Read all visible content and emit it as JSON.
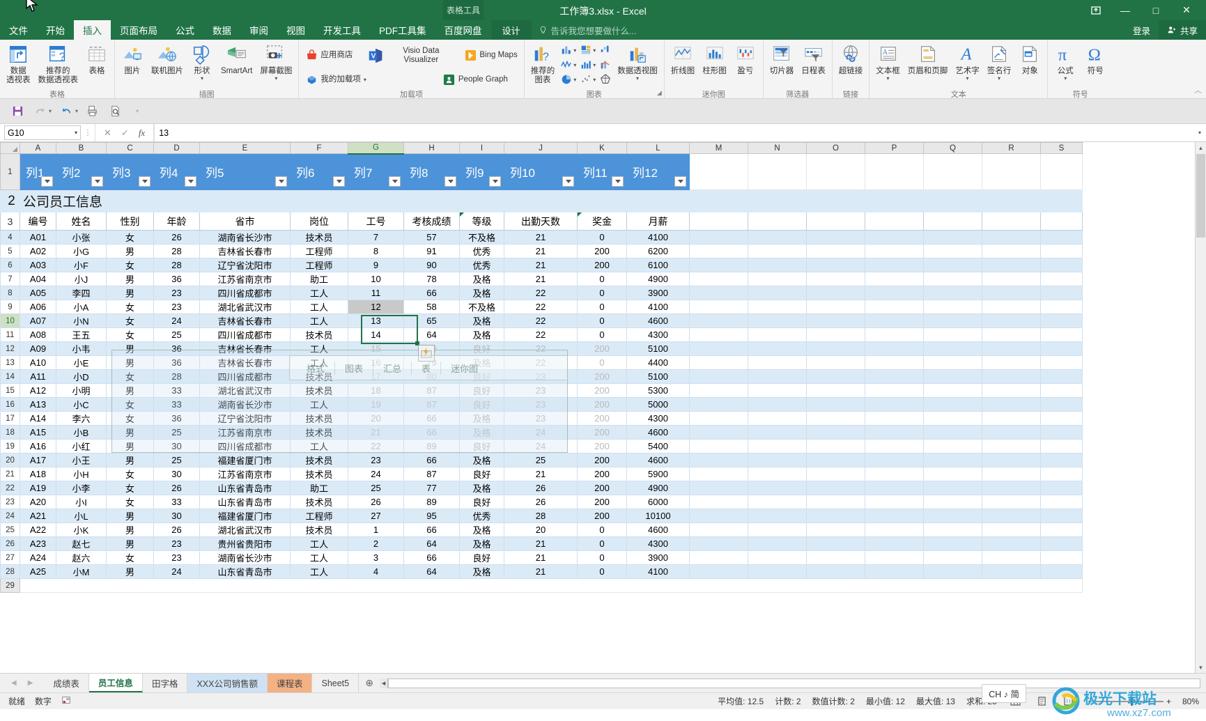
{
  "titlebar": {
    "contextual_group": "表格工具",
    "document_title": "工作簿3.xlsx - Excel",
    "ribbon_display_icon": "ribbon-display-options-icon",
    "minimize": "—",
    "maximize": "□",
    "close": "✕"
  },
  "tabs": {
    "items": [
      "文件",
      "开始",
      "插入",
      "页面布局",
      "公式",
      "数据",
      "审阅",
      "视图",
      "开发工具",
      "PDF工具集",
      "百度网盘"
    ],
    "active": "插入",
    "contextual": "设计",
    "tellme_placeholder": "告诉我您想要做什么...",
    "signin": "登录",
    "share": "共享"
  },
  "ribbon": {
    "groups": [
      {
        "name": "表格",
        "items": [
          {
            "label": "数据\n透视表",
            "icon": "pivot-table-icon"
          },
          {
            "label": "推荐的\n数据透视表",
            "icon": "recommended-pivot-icon"
          },
          {
            "label": "表格",
            "icon": "table-icon"
          }
        ]
      },
      {
        "name": "插图",
        "items": [
          {
            "label": "图片",
            "icon": "picture-icon"
          },
          {
            "label": "联机图片",
            "icon": "online-picture-icon"
          },
          {
            "label": "形状",
            "icon": "shapes-icon"
          },
          {
            "label": "SmartArt",
            "icon": "smartart-icon"
          },
          {
            "label": "屏幕截图",
            "icon": "screenshot-icon"
          }
        ]
      },
      {
        "name": "加载项",
        "items": [
          {
            "label": "应用商店",
            "icon": "store-icon"
          },
          {
            "label": "我的加载项",
            "icon": "my-addins-icon"
          },
          {
            "label": "Visio Data Visualizer",
            "icon": "visio-icon"
          },
          {
            "label": "Bing Maps",
            "icon": "bing-maps-icon"
          },
          {
            "label": "People Graph",
            "icon": "people-graph-icon"
          }
        ]
      },
      {
        "name": "图表",
        "items": [
          {
            "label": "推荐的\n图表",
            "icon": "recommended-charts-icon"
          },
          {
            "label": "数据透视图",
            "icon": "pivot-chart-icon"
          }
        ],
        "gallery": [
          "column-chart-icon",
          "hierarchy-chart-icon",
          "waterfall-chart-icon",
          "line-chart-icon",
          "statistic-chart-icon",
          "combo-chart-icon",
          "pie-chart-icon",
          "scatter-chart-icon",
          "radar-chart-icon"
        ]
      },
      {
        "name": "迷你图",
        "items": [
          {
            "label": "折线图",
            "icon": "sparkline-line-icon"
          },
          {
            "label": "柱形图",
            "icon": "sparkline-column-icon"
          },
          {
            "label": "盈亏",
            "icon": "sparkline-winloss-icon"
          }
        ]
      },
      {
        "name": "筛选器",
        "items": [
          {
            "label": "切片器",
            "icon": "slicer-icon"
          },
          {
            "label": "日程表",
            "icon": "timeline-icon"
          }
        ]
      },
      {
        "name": "链接",
        "items": [
          {
            "label": "超链接",
            "icon": "hyperlink-icon"
          }
        ]
      },
      {
        "name": "文本",
        "items": [
          {
            "label": "文本框",
            "icon": "textbox-icon"
          },
          {
            "label": "页眉和页脚",
            "icon": "header-footer-icon"
          },
          {
            "label": "艺术字",
            "icon": "wordart-icon"
          },
          {
            "label": "签名行",
            "icon": "signature-line-icon"
          },
          {
            "label": "对象",
            "icon": "object-icon"
          }
        ]
      },
      {
        "name": "符号",
        "items": [
          {
            "label": "公式",
            "icon": "equation-icon"
          },
          {
            "label": "符号",
            "icon": "symbol-icon"
          }
        ]
      }
    ]
  },
  "qat": {
    "buttons": [
      "save-icon",
      "redo-icon",
      "undo-icon",
      "print-preview-icon",
      "quick-print-icon",
      "customize-qat-icon"
    ]
  },
  "formula_bar": {
    "name_box": "G10",
    "cancel_icon": "✕",
    "confirm_icon": "✓",
    "function_icon": "fx",
    "value": "13"
  },
  "grid": {
    "column_headers": [
      "A",
      "B",
      "C",
      "D",
      "E",
      "F",
      "G",
      "H",
      "I",
      "J",
      "K",
      "L",
      "M",
      "N",
      "O",
      "P",
      "Q",
      "R",
      "S"
    ],
    "selected_column": "G",
    "selected_row": "10",
    "row_numbers": [
      "1",
      "2",
      "3",
      "4",
      "5",
      "6",
      "7",
      "8",
      "9",
      "10",
      "11",
      "12",
      "13",
      "14",
      "15",
      "16",
      "17",
      "18",
      "19",
      "20",
      "21",
      "22",
      "23",
      "24",
      "25",
      "26",
      "27",
      "28",
      "29"
    ],
    "table_header_labels": [
      "列1",
      "列2",
      "列3",
      "列4",
      "列5",
      "列6",
      "列7",
      "列8",
      "列9",
      "列10",
      "列11",
      "列12"
    ],
    "banner_title": "公司员工信息",
    "column_titles": [
      "编号",
      "姓名",
      "性别",
      "年龄",
      "省市",
      "岗位",
      "工号",
      "考核成绩",
      "等级",
      "出勤天数",
      "奖金",
      "月薪"
    ],
    "rows": [
      [
        "A01",
        "小张",
        "女",
        "26",
        "湖南省长沙市",
        "技术员",
        "7",
        "57",
        "不及格",
        "21",
        "0",
        "4100"
      ],
      [
        "A02",
        "小G",
        "男",
        "28",
        "吉林省长春市",
        "工程师",
        "8",
        "91",
        "优秀",
        "21",
        "200",
        "6200"
      ],
      [
        "A03",
        "小F",
        "女",
        "28",
        "辽宁省沈阳市",
        "工程师",
        "9",
        "90",
        "优秀",
        "21",
        "200",
        "6100"
      ],
      [
        "A04",
        "小J",
        "男",
        "36",
        "江苏省南京市",
        "助工",
        "10",
        "78",
        "及格",
        "21",
        "0",
        "4900"
      ],
      [
        "A05",
        "李四",
        "男",
        "23",
        "四川省成都市",
        "工人",
        "11",
        "66",
        "及格",
        "22",
        "0",
        "3900"
      ],
      [
        "A06",
        "小A",
        "女",
        "23",
        "湖北省武汉市",
        "工人",
        "12",
        "58",
        "不及格",
        "22",
        "0",
        "4100"
      ],
      [
        "A07",
        "小N",
        "女",
        "24",
        "吉林省长春市",
        "工人",
        "13",
        "65",
        "及格",
        "22",
        "0",
        "4600"
      ],
      [
        "A08",
        "王五",
        "女",
        "25",
        "四川省成都市",
        "技术员",
        "14",
        "64",
        "及格",
        "22",
        "0",
        "4300"
      ],
      [
        "A09",
        "小韦",
        "男",
        "36",
        "吉林省长春市",
        "工人",
        "15",
        "80",
        "良好",
        "22",
        "200",
        "5100"
      ],
      [
        "A10",
        "小E",
        "男",
        "36",
        "吉林省长春市",
        "工人",
        "16",
        "79",
        "及格",
        "22",
        "0",
        "4400"
      ],
      [
        "A11",
        "小D",
        "女",
        "28",
        "四川省成都市",
        "技术员",
        "17",
        "80",
        "良好",
        "23",
        "200",
        "5100"
      ],
      [
        "A12",
        "小明",
        "男",
        "33",
        "湖北省武汉市",
        "技术员",
        "18",
        "87",
        "良好",
        "23",
        "200",
        "5300"
      ],
      [
        "A13",
        "小C",
        "女",
        "33",
        "湖南省长沙市",
        "工人",
        "19",
        "87",
        "良好",
        "23",
        "200",
        "5000"
      ],
      [
        "A14",
        "李六",
        "女",
        "36",
        "辽宁省沈阳市",
        "技术员",
        "20",
        "66",
        "及格",
        "23",
        "200",
        "4300"
      ],
      [
        "A15",
        "小B",
        "男",
        "25",
        "江苏省南京市",
        "技术员",
        "21",
        "66",
        "及格",
        "24",
        "200",
        "4600"
      ],
      [
        "A16",
        "小红",
        "男",
        "30",
        "四川省成都市",
        "工人",
        "22",
        "89",
        "良好",
        "24",
        "200",
        "5400"
      ],
      [
        "A17",
        "小王",
        "男",
        "25",
        "福建省厦门市",
        "技术员",
        "23",
        "66",
        "及格",
        "25",
        "200",
        "4600"
      ],
      [
        "A18",
        "小H",
        "女",
        "30",
        "江苏省南京市",
        "技术员",
        "24",
        "87",
        "良好",
        "21",
        "200",
        "5900"
      ],
      [
        "A19",
        "小李",
        "女",
        "26",
        "山东省青岛市",
        "助工",
        "25",
        "77",
        "及格",
        "26",
        "200",
        "4900"
      ],
      [
        "A20",
        "小I",
        "女",
        "33",
        "山东省青岛市",
        "技术员",
        "26",
        "89",
        "良好",
        "26",
        "200",
        "6000"
      ],
      [
        "A21",
        "小L",
        "男",
        "30",
        "福建省厦门市",
        "工程师",
        "27",
        "95",
        "优秀",
        "28",
        "200",
        "10100"
      ],
      [
        "A22",
        "小K",
        "男",
        "26",
        "湖北省武汉市",
        "技术员",
        "1",
        "66",
        "及格",
        "20",
        "0",
        "4600"
      ],
      [
        "A23",
        "赵七",
        "男",
        "23",
        "贵州省贵阳市",
        "工人",
        "2",
        "64",
        "及格",
        "21",
        "0",
        "4300"
      ],
      [
        "A24",
        "赵六",
        "女",
        "23",
        "湖南省长沙市",
        "工人",
        "3",
        "66",
        "良好",
        "21",
        "0",
        "3900"
      ],
      [
        "A25",
        "小M",
        "男",
        "24",
        "山东省青岛市",
        "工人",
        "4",
        "64",
        "及格",
        "21",
        "0",
        "4100"
      ]
    ]
  },
  "quick_analysis": {
    "icon": "quick-analysis-icon",
    "tabs": [
      "格式",
      "图表",
      "汇总",
      "表",
      "迷你图"
    ]
  },
  "sheet_tabs": {
    "prev_icon": "◀",
    "next_icon": "▶",
    "items": [
      {
        "label": "成绩表",
        "color": "none",
        "active": false
      },
      {
        "label": "员工信息",
        "color": "none",
        "active": true
      },
      {
        "label": "田字格",
        "color": "none",
        "active": false
      },
      {
        "label": "XXX公司销售额",
        "color": "#cfe2f3",
        "active": false
      },
      {
        "label": "课程表",
        "color": "#f4b183",
        "active": false
      },
      {
        "label": "Sheet5",
        "color": "none",
        "active": false
      }
    ],
    "add_label": "⊕"
  },
  "status_bar": {
    "mode": "就绪",
    "num_mode": "数字",
    "record_icon": "macro-record-icon",
    "stats": [
      {
        "label": "平均值: 12.5"
      },
      {
        "label": "计数: 2"
      },
      {
        "label": "数值计数: 2"
      },
      {
        "label": "最小值: 12"
      },
      {
        "label": "最大值: 13"
      },
      {
        "label": "求和: 25"
      }
    ],
    "views": [
      "normal-view-icon",
      "page-layout-view-icon",
      "page-break-view-icon"
    ],
    "zoom_out": "−",
    "zoom_in": "+",
    "zoom_level": "80%",
    "ime_badge": "CH ♪ 简"
  },
  "watermark": {
    "title": "极光下载站",
    "url": "www.xz7.com"
  },
  "colors": {
    "excel_green": "#217346",
    "table_header_blue": "#4d93d9",
    "band_blue": "#dbeaf7",
    "selection_green": "#217346"
  }
}
